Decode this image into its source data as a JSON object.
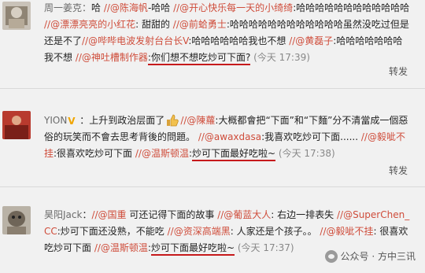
{
  "posts": [
    {
      "user": "周一姜克：",
      "segments": [
        {
          "t": "哈 ",
          "c": "plain"
        },
        {
          "t": "//@陈海帆",
          "c": "mention"
        },
        {
          "t": "-哈哈 ",
          "c": "plain"
        },
        {
          "t": "//@开心快乐每一天的小绮绮",
          "c": "mention"
        },
        {
          "t": ":哈哈哈哈哈哈哈哈哈哈哈哈 ",
          "c": "plain"
        },
        {
          "t": "//@漂漂亮亮的小红花",
          "c": "mention"
        },
        {
          "t": ": 甜甜的 ",
          "c": "plain"
        },
        {
          "t": "//@前蛤勇士",
          "c": "mention"
        },
        {
          "t": ":哈哈哈哈哈哈哈哈哈哈哈哈虽然没吃过但是还是不了",
          "c": "plain"
        },
        {
          "t": "//@哔哔电波发射台台长V",
          "c": "mention"
        },
        {
          "t": ":哈哈哈哈哈哈我也不想 ",
          "c": "plain"
        },
        {
          "t": "//@黄磊子",
          "c": "mention"
        },
        {
          "t": ":哈哈哈哈哈哈哈我不想 ",
          "c": "plain"
        },
        {
          "t": "//@神吐槽制作器",
          "c": "mention"
        },
        {
          "t": ":你们想不想吃炒可下面?",
          "c": "plain",
          "u": true
        },
        {
          "t": " (今天 17:39)",
          "c": "time"
        }
      ],
      "repost": "转发"
    },
    {
      "user": "YION",
      "segments": [
        {
          "t": "：上升到政治层面了",
          "c": "plain"
        },
        {
          "t": "//@陳蘿",
          "c": "mention"
        },
        {
          "t": ":大概都會把“下面”和“下麵”分不清當成一個惡俗的玩笑而不會去思考背後的問題。 ",
          "c": "plain"
        },
        {
          "t": "//@awaxdasa",
          "c": "mention"
        },
        {
          "t": ":我喜欢吃炒可下面...... ",
          "c": "plain"
        },
        {
          "t": "//@毅呲不挂",
          "c": "mention"
        },
        {
          "t": ":很喜欢吃炒可下面 ",
          "c": "plain"
        },
        {
          "t": "//@温斯顿温",
          "c": "mention"
        },
        {
          "t": ":",
          "c": "plain"
        },
        {
          "t": "炒可下面最好吃啦~",
          "c": "plain",
          "u": true
        },
        {
          "t": " (今天 17:38)",
          "c": "time"
        }
      ],
      "repost": "转发"
    },
    {
      "user": "昊阳Jack",
      "segments": [
        {
          "t": "：",
          "c": "plain"
        },
        {
          "t": "//@国重",
          "c": "mention"
        },
        {
          "t": " 可还记得下面的故事 ",
          "c": "plain"
        },
        {
          "t": "//@葡蓝大人",
          "c": "mention"
        },
        {
          "t": ": 右边一排表失 ",
          "c": "plain"
        },
        {
          "t": "//@SuperChen_CC",
          "c": "mention"
        },
        {
          "t": ":炒可下面还没熟，不能吃 ",
          "c": "plain"
        },
        {
          "t": "//@资深高端黑",
          "c": "mention"
        },
        {
          "t": ": 人家还是个孩子。。 ",
          "c": "plain"
        },
        {
          "t": "//@毅呲不挂",
          "c": "mention"
        },
        {
          "t": ": 很喜欢吃炒可下面 ",
          "c": "plain"
        },
        {
          "t": "//@温斯顿温",
          "c": "mention"
        },
        {
          "t": ":",
          "c": "plain"
        },
        {
          "t": "炒可下面最好吃啦~",
          "c": "plain",
          "u": true
        },
        {
          "t": " (今天 17:37)",
          "c": "time"
        }
      ],
      "repost": ""
    }
  ],
  "watermark": "公众号 · 方中三讯",
  "colors": {
    "mention": "#cf4d3b",
    "underline": "#c6191b",
    "background": "#f1f1f1"
  }
}
